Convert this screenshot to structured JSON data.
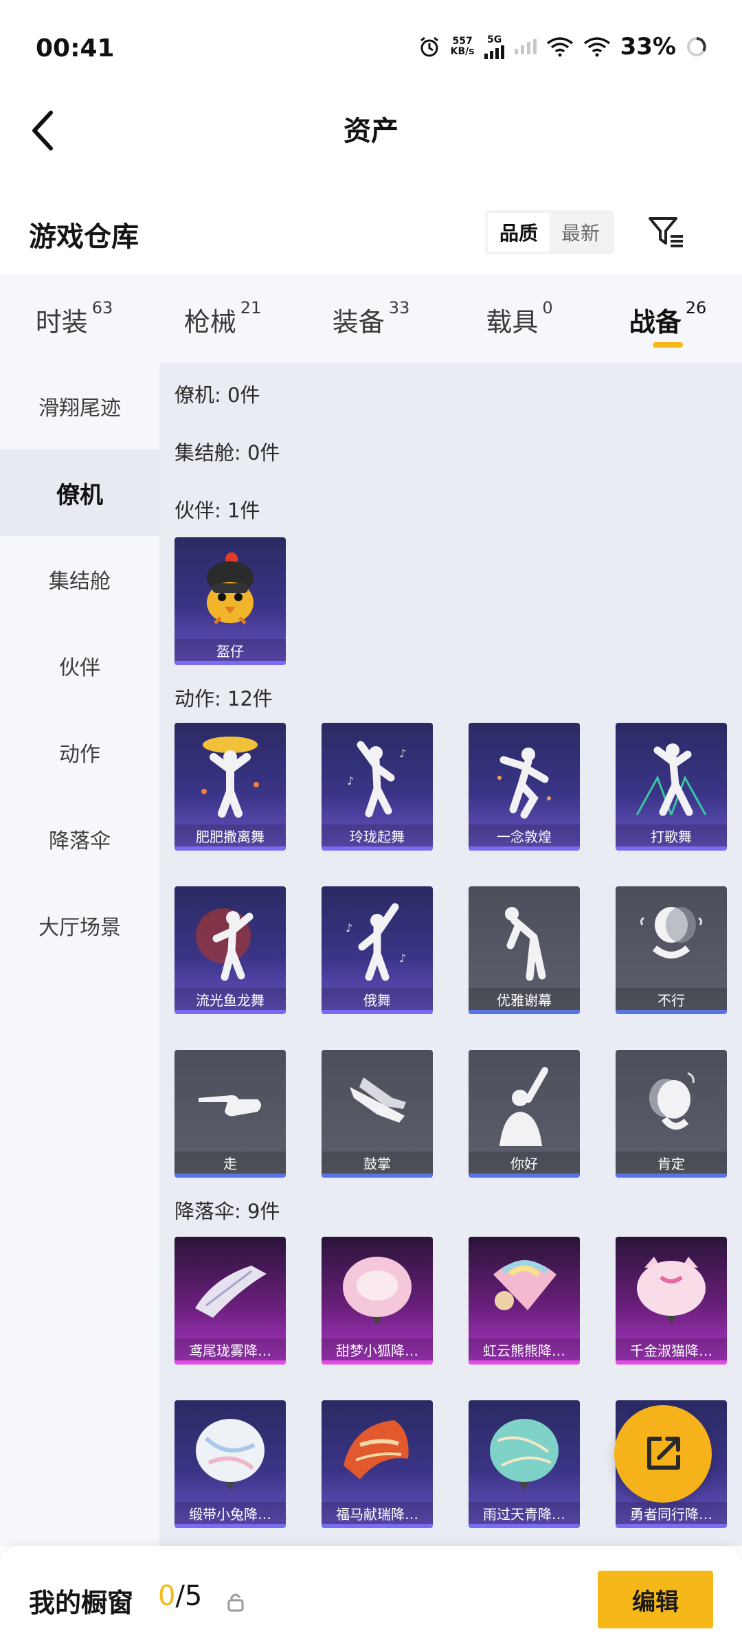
{
  "status_bar": {
    "time": "00:41",
    "net_speed_value": "557",
    "net_speed_unit": "KB/s",
    "network": "5G",
    "battery": "33%"
  },
  "header": {
    "title": "资产",
    "back_icon": "chevron-left-icon"
  },
  "section": {
    "title": "游戏仓库",
    "sort_options": [
      "品质",
      "最新"
    ],
    "sort_selected": "品质",
    "filter_icon": "filter-icon"
  },
  "tabs": [
    {
      "label": "时装",
      "count": "63"
    },
    {
      "label": "枪械",
      "count": "21"
    },
    {
      "label": "装备",
      "count": "33"
    },
    {
      "label": "载具",
      "count": "0"
    },
    {
      "label": "战备",
      "count": "26"
    }
  ],
  "active_tab": "战备",
  "sidenav": [
    "滑翔尾迹",
    "僚机",
    "集结舱",
    "伙伴",
    "动作",
    "降落伞",
    "大厅场景"
  ],
  "active_side": "僚机",
  "groups": {
    "wingman": {
      "title": "僚机: 0件"
    },
    "pod": {
      "title": "集结舱: 0件"
    },
    "companion": {
      "title": "伙伴: 1件",
      "items": [
        "盔仔"
      ]
    },
    "emote": {
      "title": "动作: 12件",
      "items": [
        "肥肥撒离舞",
        "玲珑起舞",
        "一念敦煌",
        "打歌舞",
        "流光鱼龙舞",
        "俄舞",
        "优雅谢幕",
        "不行",
        "走",
        "鼓掌",
        "你好",
        "肯定"
      ]
    },
    "parachute": {
      "title": "降落伞: 9件",
      "items": [
        "鸢尾珑雾降…",
        "甜梦小狐降…",
        "虹云熊熊降…",
        "千金淑猫降…",
        "缎带小兔降…",
        "福马献瑞降…",
        "雨过天青降…",
        "勇者同行降…"
      ]
    }
  },
  "fab_icon": "share-icon",
  "bottom": {
    "label": "我的橱窗",
    "count_current": "0",
    "count_total": "/5",
    "edit_label": "编辑"
  },
  "colors": {
    "accent": "#f5b818",
    "purple_card": "#3a3486",
    "pink_card": "#6a1f7c",
    "gray_card": "#565965"
  }
}
